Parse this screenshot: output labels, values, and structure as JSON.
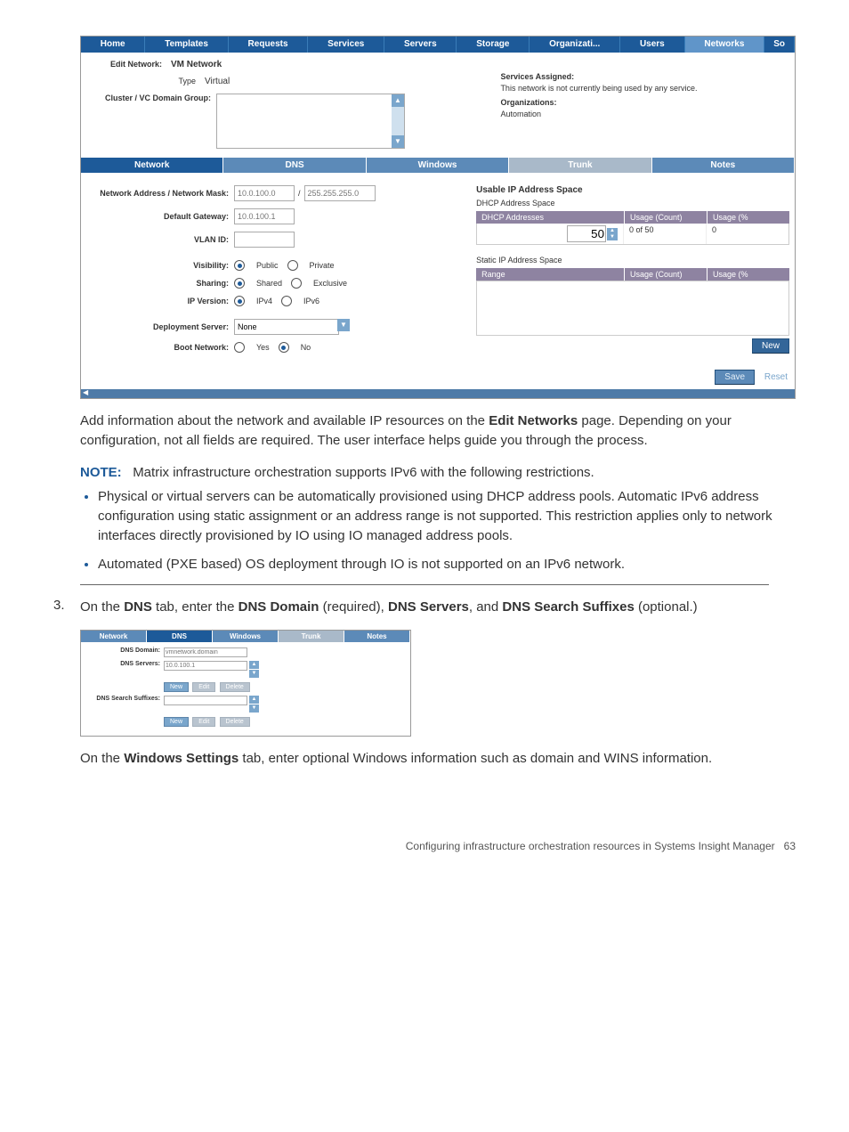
{
  "nav": {
    "home": "Home",
    "templates": "Templates",
    "requests": "Requests",
    "services": "Services",
    "servers": "Servers",
    "storage": "Storage",
    "organizati": "Organizati...",
    "users": "Users",
    "networks": "Networks",
    "so": "So"
  },
  "editNetwork": {
    "label": "Edit Network:",
    "value": "VM Network",
    "typeLabel": "Type",
    "typeValue": "Virtual",
    "clusterLabel": "Cluster / VC Domain Group:"
  },
  "right": {
    "servicesAssignedLabel": "Services Assigned:",
    "servicesAssignedText": "This network is not currently being used by any service.",
    "orgsLabel": "Organizations:",
    "orgsValue": "Automation"
  },
  "subTabs": {
    "network": "Network",
    "dns": "DNS",
    "windows": "Windows",
    "trunk": "Trunk",
    "notes": "Notes"
  },
  "form": {
    "netMask": "Network Address / Network Mask:",
    "netMaskPh1": "10.0.100.0",
    "netMaskPh2": "255.255.255.0",
    "gateway": "Default Gateway:",
    "gatewayPh": "10.0.100.1",
    "vlan": "VLAN ID:",
    "visibility": "Visibility:",
    "visPublic": "Public",
    "visPrivate": "Private",
    "sharing": "Sharing:",
    "sharShared": "Shared",
    "sharExclusive": "Exclusive",
    "ipversion": "IP Version:",
    "ipv4": "IPv4",
    "ipv6": "IPv6",
    "deployment": "Deployment Server:",
    "deployNone": "None",
    "boot": "Boot Network:",
    "bootYes": "Yes",
    "bootNo": "No"
  },
  "ipSpace": {
    "header": "Usable IP Address Space",
    "dhcpSpace": "DHCP Address Space",
    "dhcpAddresses": "DHCP Addresses",
    "usageCount": "Usage (Count)",
    "usagePct": "Usage (%",
    "dhcpVal": "50",
    "dhcpCount": "0 of 50",
    "dhcpPct": "0",
    "staticSpace": "Static IP Address Space",
    "range": "Range",
    "newBtn": "New"
  },
  "buttons": {
    "save": "Save",
    "reset": "Reset"
  },
  "body1": {
    "p1a": "Add information about the network and available IP resources on the ",
    "p1b": "Edit Networks",
    "p1c": " page. Depending on your configuration, not all fields are required. The user interface helps guide you through the process.",
    "notePrefix": "NOTE:",
    "noteText": "Matrix infrastructure orchestration supports IPv6 with the following restrictions.",
    "bullet1": "Physical or virtual servers can be automatically provisioned using DHCP address pools. Automatic IPv6 address configuration using static assignment or an address range is not supported. This restriction applies only to network interfaces directly provisioned by IO using IO managed address pools.",
    "bullet2": "Automated (PXE based) OS deployment through IO is not supported on an IPv6 network."
  },
  "step3": {
    "num": "3.",
    "a": "On the ",
    "b": "DNS",
    "c": " tab, enter the ",
    "d": "DNS Domain",
    "e": " (required), ",
    "f": "DNS Servers",
    "g": ", and ",
    "h": "DNS Search Suffixes",
    "i": " (optional.)"
  },
  "mini": {
    "tabs": {
      "network": "Network",
      "dns": "DNS",
      "windows": "Windows",
      "trunk": "Trunk",
      "notes": "Notes"
    },
    "domainLabel": "DNS Domain:",
    "domainPh": "vmnetwork.domain",
    "serversLabel": "DNS Servers:",
    "serversPh": "10.0.100.1",
    "suffixLabel": "DNS Search Suffixes:",
    "newBtn": "New",
    "editBtn": "Edit",
    "deleteBtn": "Delete"
  },
  "body2": {
    "a": "On the ",
    "b": "Windows Settings",
    "c": " tab, enter optional Windows information such as domain and WINS information."
  },
  "footer": {
    "text": "Configuring infrastructure orchestration resources in Systems Insight Manager",
    "page": "63"
  }
}
